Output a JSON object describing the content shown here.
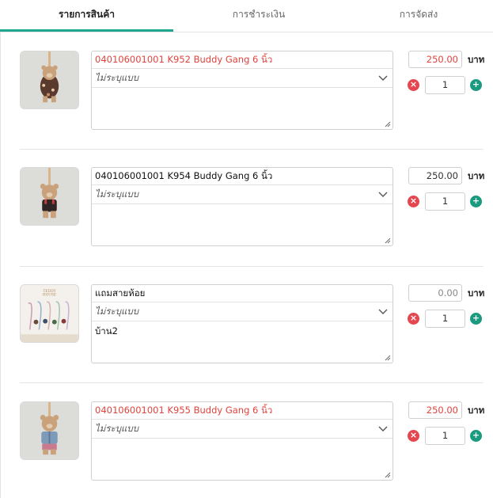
{
  "tabs": [
    {
      "label": "รายการสินค้า",
      "active": true
    },
    {
      "label": "การชำระเงิน",
      "active": false
    },
    {
      "label": "การจัดส่ง",
      "active": false
    }
  ],
  "currency_label": "บาท",
  "items": [
    {
      "name": "040106001001 K952 Buddy Gang 6 นิ้ว",
      "name_color": "#e0433c",
      "option_placeholder": "ไม่ระบุแบบ",
      "note": "",
      "price": "250.00",
      "quantity": "1",
      "image": "teddy-bear-floral-outfit"
    },
    {
      "name": "040106001001 K954 Buddy Gang 6 นิ้ว",
      "name_color": "#111111",
      "option_placeholder": "ไม่ระบุแบบ",
      "note": "",
      "price": "250.00",
      "quantity": "1",
      "image": "teddy-bear-black-overalls"
    },
    {
      "name": "แถมสายห้อย",
      "name_color": "#111111",
      "option_placeholder": "ไม่ระบุแบบ",
      "note": "บ้าน2",
      "price": "0.00",
      "quantity": "1",
      "image": "teddy-house-lanyard-straps"
    },
    {
      "name": "040106001001 K955 Buddy Gang 6 นิ้ว",
      "name_color": "#e0433c",
      "option_placeholder": "ไม่ระบุแบบ",
      "note": "",
      "price": "250.00",
      "quantity": "1",
      "image": "teddy-bear-blue-shirt"
    }
  ],
  "lanyard_image_text": "TEDDY HOUSE",
  "colors": {
    "accent": "#1fa68e",
    "minus": "#e4474f",
    "plus": "#1a9a7e",
    "name_red": "#e0433c"
  }
}
